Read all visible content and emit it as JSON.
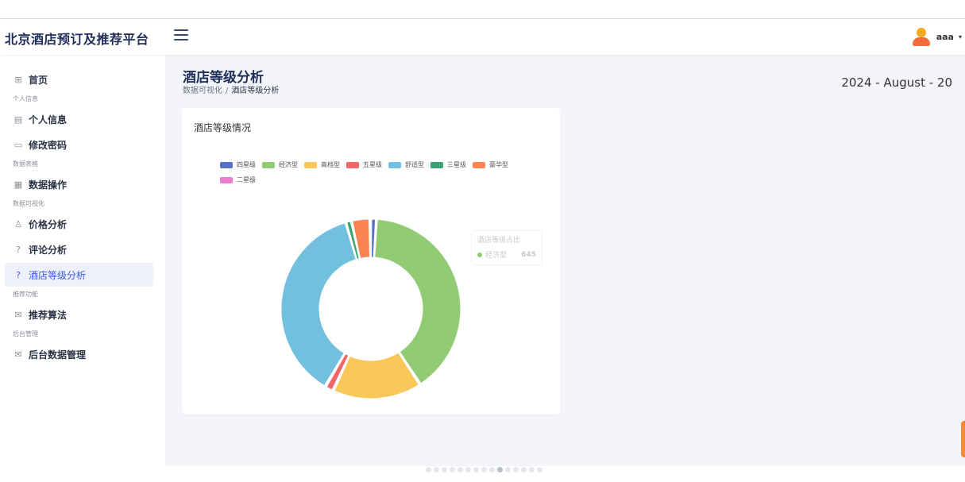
{
  "app": {
    "title": "北京酒店预订及推荐平台"
  },
  "user": {
    "name": "aaa"
  },
  "sidebar": {
    "home": {
      "label": "首页",
      "icon": "grid-icon"
    },
    "sections": {
      "personal": "个人信息",
      "data_table": "数据表格",
      "visualization": "数据可视化",
      "recommend": "推荐功能",
      "admin": "后台管理"
    },
    "items": {
      "profile": "个人信息",
      "password": "修改密码",
      "data_ops": "数据操作",
      "price": "价格分析",
      "review": "评论分析",
      "hotel_grade": "酒店等级分析",
      "algorithm": "推荐算法",
      "admin_data": "后台数据管理"
    }
  },
  "page": {
    "title": "酒店等级分析",
    "breadcrumb": {
      "parent": "数据可视化",
      "separator": "/",
      "current": "酒店等级分析"
    },
    "date": "2024 - August - 20"
  },
  "card": {
    "title": "酒店等级情况"
  },
  "tooltip": {
    "title": "酒店等级占比",
    "series": "经济型",
    "value": "645",
    "color": "#91cc75"
  },
  "chart_data": {
    "type": "pie",
    "donut": true,
    "title": "",
    "legend_position": "top",
    "slices": [
      {
        "name": "四星级",
        "value": 15,
        "color": "#5470c6"
      },
      {
        "name": "经济型",
        "value": 645,
        "color": "#91cc75"
      },
      {
        "name": "高档型",
        "value": 260,
        "color": "#fac858"
      },
      {
        "name": "五星级",
        "value": 25,
        "color": "#ee6666"
      },
      {
        "name": "舒适型",
        "value": 600,
        "color": "#73c0de"
      },
      {
        "name": "三星级",
        "value": 15,
        "color": "#3ba272"
      },
      {
        "name": "豪华型",
        "value": 55,
        "color": "#fc8452"
      },
      {
        "name": "二星级",
        "value": 2,
        "color": "#ea7ccc"
      }
    ]
  }
}
